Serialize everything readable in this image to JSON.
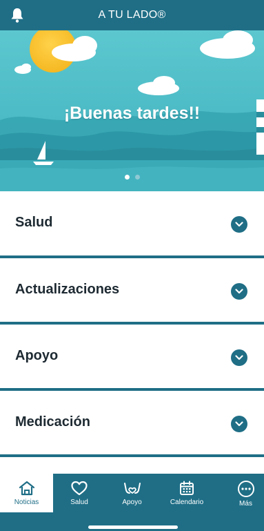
{
  "header": {
    "title": "A TU LADO®",
    "bell_icon": "bell-icon"
  },
  "hero": {
    "greeting": "¡Buenas tardes!!",
    "carousel_total": 2,
    "carousel_active": 1
  },
  "sections": [
    {
      "label": "Salud"
    },
    {
      "label": "Actualizaciones"
    },
    {
      "label": "Apoyo"
    },
    {
      "label": "Medicación"
    }
  ],
  "nav": {
    "items": [
      {
        "label": "Noticias",
        "icon": "home-icon",
        "active": true
      },
      {
        "label": "Salud",
        "icon": "heart-icon",
        "active": false
      },
      {
        "label": "Apoyo",
        "icon": "hands-icon",
        "active": false
      },
      {
        "label": "Calendario",
        "icon": "calendar-icon",
        "active": false
      },
      {
        "label": "Más",
        "icon": "more-icon",
        "active": false
      }
    ]
  },
  "colors": {
    "primary": "#1f6e86",
    "text": "#1e2a32",
    "background": "#ffffff"
  }
}
